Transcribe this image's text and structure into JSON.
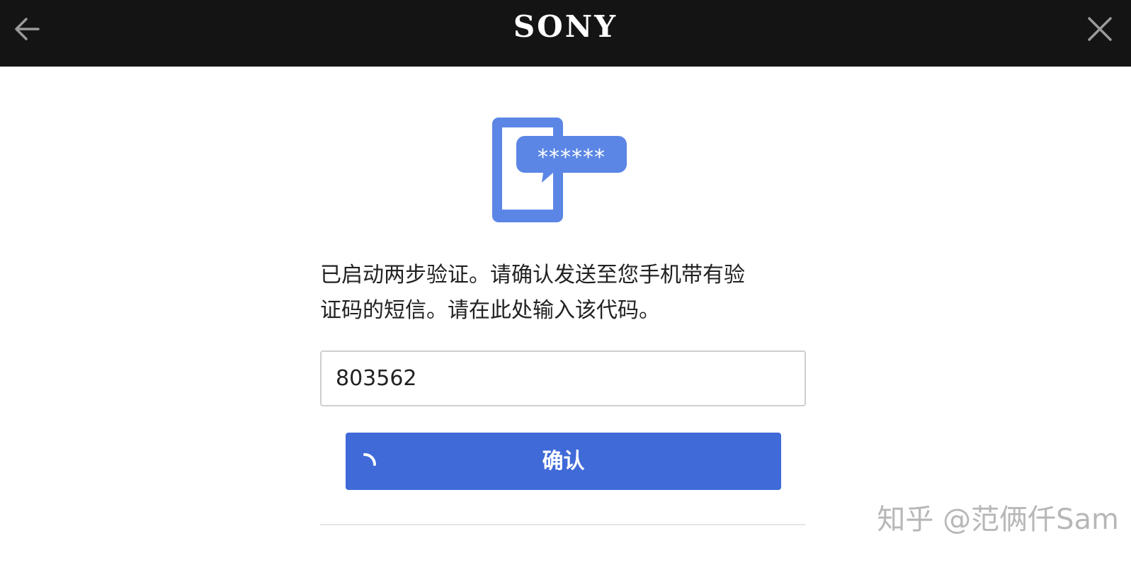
{
  "header": {
    "logo_text": "SONY",
    "back_icon": "arrow-left-icon",
    "close_icon": "close-icon",
    "background": "#141414"
  },
  "illustration": {
    "icon": "phone-sms-code-icon",
    "bubble_text": "******",
    "color": "#5b86e5"
  },
  "message": {
    "line1": "已启动两步验证。请确认发送至您手机带有验",
    "line2": "证码的短信。请在此处输入该代码。"
  },
  "code_input": {
    "value": "803562"
  },
  "confirm_button": {
    "label": "确认",
    "spinner_icon": "loading-spinner-icon",
    "color": "#3f6ad8"
  },
  "watermark": {
    "text": "知乎 @范俩仟Sam"
  }
}
